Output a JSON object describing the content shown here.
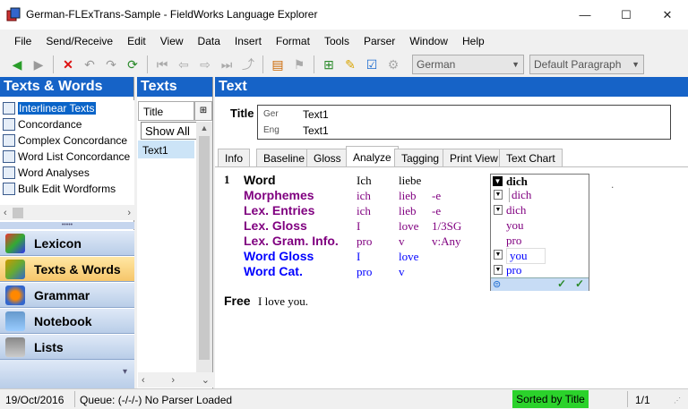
{
  "window": {
    "title": "German-FLExTrans-Sample - FieldWorks Language Explorer",
    "minimize": "—",
    "maximize": "☐",
    "close": "✕"
  },
  "menu": [
    "File",
    "Send/Receive",
    "Edit",
    "View",
    "Data",
    "Insert",
    "Format",
    "Tools",
    "Parser",
    "Window",
    "Help"
  ],
  "toolbar": {
    "writing_system": "German",
    "style": "Default Paragraph"
  },
  "left": {
    "header": "Texts & Words",
    "tools": [
      "Interlinear Texts",
      "Concordance",
      "Complex Concordance",
      "Word List Concordance",
      "Word Analyses",
      "Bulk Edit Wordforms"
    ],
    "areas": [
      "Lexicon",
      "Texts & Words",
      "Grammar",
      "Notebook",
      "Lists"
    ]
  },
  "texts": {
    "header": "Texts",
    "column": "Title",
    "filter": "Show All",
    "items": [
      "Text1"
    ]
  },
  "main": {
    "header": "Text",
    "title_label": "Title",
    "titles": [
      {
        "ws": "Ger",
        "value": "Text1"
      },
      {
        "ws": "Eng",
        "value": "Text1"
      }
    ],
    "tabs": [
      "Info",
      "Baseline",
      "Gloss",
      "Analyze",
      "Tagging",
      "Print View",
      "Text Chart"
    ],
    "active_tab": "Analyze",
    "interlinear": {
      "number": "1",
      "rows": [
        {
          "label": "Word",
          "color": "#000000",
          "cells": [
            "Ich",
            "liebe",
            ""
          ]
        },
        {
          "label": "Morphemes",
          "color": "#800080",
          "cells": [
            "ich",
            "lieb",
            "-e"
          ]
        },
        {
          "label": "Lex. Entries",
          "color": "#800080",
          "cells": [
            "ich",
            "lieb",
            "-e"
          ]
        },
        {
          "label": "Lex. Gloss",
          "color": "#800080",
          "cells": [
            "I",
            "love",
            "1/3SG"
          ]
        },
        {
          "label": "Lex. Gram. Info.",
          "color": "#800080",
          "cells": [
            "pro",
            "v",
            "v:Any"
          ]
        },
        {
          "label": "Word Gloss",
          "color": "#0000ff",
          "cells": [
            "I",
            "love",
            ""
          ]
        },
        {
          "label": "Word Cat.",
          "color": "#0000ff",
          "cells": [
            "pro",
            "v",
            ""
          ]
        }
      ],
      "free_label": "Free",
      "free_text": "I love you."
    },
    "sandbox": {
      "word": "dich",
      "morpheme": "dich",
      "entry": "dich",
      "gloss": "you",
      "gram": "pro",
      "word_gloss": "you",
      "word_cat": "pro"
    }
  },
  "status": {
    "date": "19/Oct/2016",
    "queue": "Queue: (-/-/-) No Parser Loaded",
    "sort": "Sorted by Title",
    "record": "1/1"
  },
  "colors": {
    "header": "#1663c7",
    "sort_badge": "#2bd22b"
  }
}
